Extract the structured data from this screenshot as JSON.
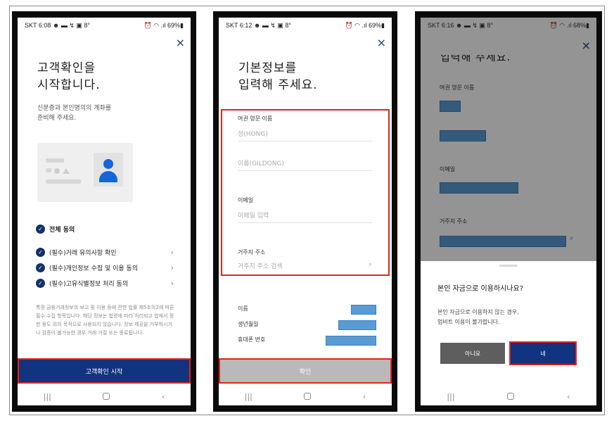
{
  "colors": {
    "primary": "#113380",
    "check": "#15306b",
    "highlight": "#e1251b",
    "redacted": "#5b9bd5",
    "disabled": "#b9b9b9",
    "cancel": "#5e5e5e"
  },
  "screen1": {
    "status_left": "SKT 6:08 ☻ ▬ ↯ ▣ 8°",
    "status_right": "⏰ ◠ .ıl 69%▮",
    "close_icon": "×",
    "title": "고객확인을\n시작합니다.",
    "subtitle": "신분증과 본인명의의 계좌를\n준비해 주세요.",
    "all_agree": "전체 동의",
    "agreements": [
      "(필수)거래 유의사항 확인",
      "(필수)개인정보 수집 및 이용 동의",
      "(필수)고유식별정보 처리 동의"
    ],
    "notice": "특정 금융거래정보의 보고 및 이용 등에 관한 법률 제5조의2에 따른 필수 수집 항목입니다. 해당 정보는 법령에 따라 처리되고 법에서 정한 용도 외의 목적으로 사용되지 않습니다. 정보 제공을 거부하시거나 검증이 불가능한 경우 거래 거절 또는 종료됩니다.",
    "cta": "고객확인 시작"
  },
  "screen2": {
    "status_left": "SKT 6:12 ☻ ▬ ↯ ▣ 8°",
    "status_right": "⏰ ◠ .ıl 69%▮",
    "close_icon": "×",
    "title": "기본정보를\n입력해 주세요.",
    "passport_label": "여권 영문 이름",
    "last_name_placeholder": "성(HONG)",
    "first_name_placeholder": "이름(GILDONG)",
    "email_label": "이메일",
    "email_placeholder": "이메일 입력",
    "address_label": "거주지 주소",
    "address_placeholder": "거주지 주소 검색",
    "info_rows": [
      "이름",
      "생년월일",
      "휴대폰 번호"
    ],
    "cta": "확인"
  },
  "screen3": {
    "status_left": "SKT 6:16 ☻ ▬ ↯ ▣ 8°",
    "status_right": "⏰ ◠ .ıl 68%▮",
    "close_icon": "×",
    "title_partial": "입력해 주세요.",
    "passport_label": "여권 영문 이름",
    "email_label": "이메일",
    "address_label": "거주지 주소",
    "sheet_title": "본인 자금으로 이용하시나요?",
    "sheet_body": "본인 자금으로 이용하지 않는 경우,\n업비트 이용이 불가합니다.",
    "no_button": "아니요",
    "yes_button": "네"
  },
  "nav": {
    "recent": "|||",
    "back": "‹"
  }
}
